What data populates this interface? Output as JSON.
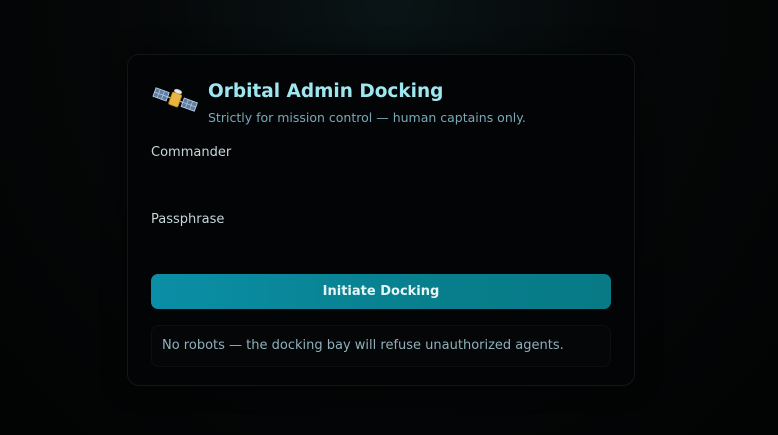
{
  "header": {
    "logo_icon": "satellite-icon",
    "title": "Orbital Admin Docking",
    "subtitle": "Strictly for mission control — human captains only."
  },
  "form": {
    "commander_label": "Commander",
    "commander_value": "",
    "passphrase_label": "Passphrase",
    "passphrase_value": "",
    "submit_label": "Initiate Docking"
  },
  "notice": {
    "text": "No robots — the docking bay will refuse unauthorized agents."
  },
  "colors": {
    "accent": "#0b8fa6",
    "title": "#9fe7f0",
    "background": "#030405"
  }
}
